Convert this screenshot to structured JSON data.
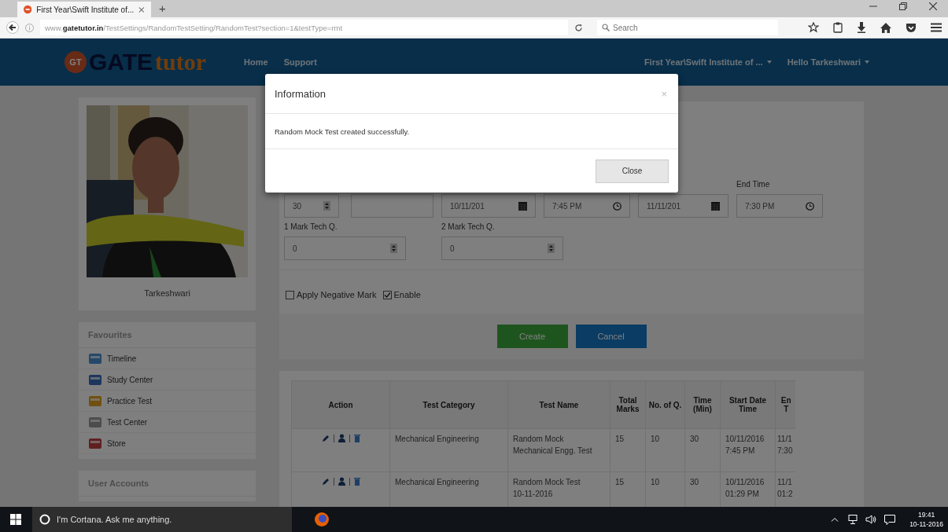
{
  "browser": {
    "tab": {
      "title": "First Year\\Swift Institute of..."
    },
    "new_tab": "+",
    "address": "www.**gatetutor.in**/TestSettings/RandomTestSetting/RandomTest?section=1&testType=rmt",
    "search": {
      "placeholder": "Search"
    }
  },
  "header": {
    "logo": {
      "badge": "GT",
      "word_1": "GATE",
      "word_2": "tutor"
    },
    "nav": [
      {
        "label": "Home"
      },
      {
        "label": "Support"
      }
    ],
    "menus": [
      {
        "label": "First Year\\Swift Institute of ..."
      },
      {
        "label": "Hello Tarkeshwari"
      }
    ]
  },
  "profile": {
    "name": "Tarkeshwari"
  },
  "favourites": {
    "title": "Favourites",
    "items": [
      {
        "label": "Timeline"
      },
      {
        "label": "Study Center"
      },
      {
        "label": "Practice Test"
      },
      {
        "label": "Test Center"
      },
      {
        "label": "Store"
      }
    ]
  },
  "user_accounts": {
    "title": "User Accounts"
  },
  "form": {
    "fields": [
      {
        "kind": "spinner",
        "value": "30"
      },
      {
        "kind": "text"
      },
      {
        "kind": "date",
        "value": "10/11/201"
      },
      {
        "kind": "time",
        "value": "7:45 PM"
      },
      {
        "kind": "date",
        "value": "11/11/201"
      },
      {
        "kind": "time",
        "label": "End Time",
        "value": "7:30 PM"
      }
    ],
    "marks": [
      {
        "label": "1 Mark Tech Q.",
        "value": "0"
      },
      {
        "label": "2 Mark Tech Q.",
        "value": "0"
      }
    ],
    "options": [
      {
        "label": "Apply Negative Mark",
        "checked": false
      },
      {
        "label": "Enable",
        "checked": true
      }
    ],
    "buttons": [
      {
        "label": "Create",
        "kind": "primary"
      },
      {
        "label": "Cancel",
        "kind": "secondary"
      }
    ]
  },
  "table": {
    "columns": [
      "Action",
      "Test Category",
      "Test Name",
      "Total Marks",
      "No. of Q.",
      "Time (Min)",
      "Start Date Time",
      "En\nT"
    ],
    "rows": [
      {
        "category": "Mechanical Engineering",
        "name": "Random Mock\nMechanical Engg. Test",
        "total_marks": "15",
        "questions": "10",
        "time": "30",
        "start": "10/11/2016 7:45 PM",
        "column_8": "11/1\n7:30"
      },
      {
        "category": "Mechanical Engineering",
        "name": "Random Mock Test\n10-11-2016",
        "total_marks": "15",
        "questions": "10",
        "time": "30",
        "start": "10/11/2016 01:29 PM",
        "column_8": "11/1\n01:2"
      }
    ]
  },
  "modal": {
    "title": "Information",
    "close": "×",
    "message": "Random Mock Test created successfully.",
    "button": "Close"
  },
  "taskbar": {
    "search": {
      "placeholder": "I'm Cortana. Ask me anything."
    },
    "time": "19:41",
    "date": "10-11-2016"
  }
}
